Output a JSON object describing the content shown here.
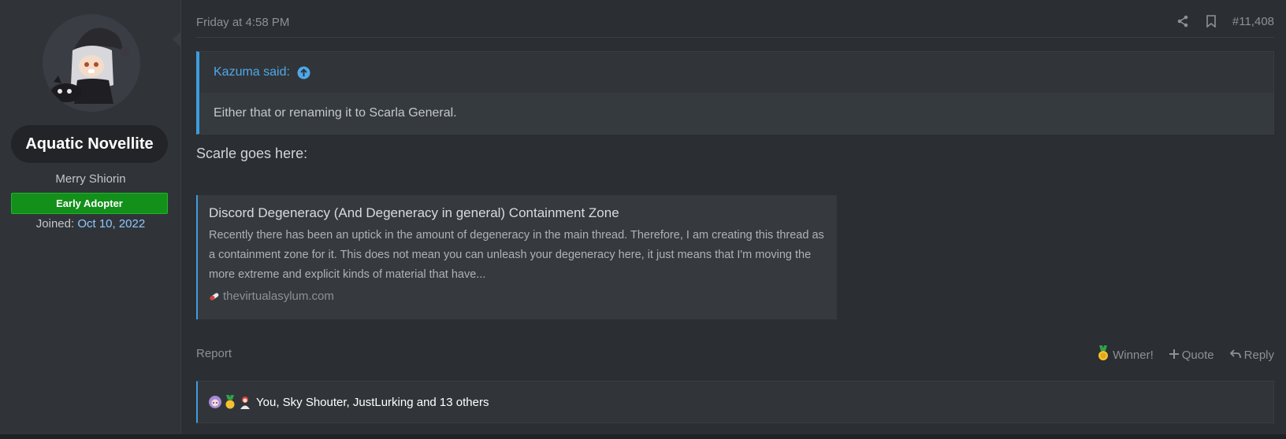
{
  "user": {
    "name": "Aquatic Novellite",
    "title": "Merry Shiorin",
    "banner": "Early Adopter",
    "joined_label": "Joined:",
    "joined_value": "Oct 10, 2022"
  },
  "post": {
    "date": "Friday at 4:58 PM",
    "number": "#11,408",
    "quote": {
      "author": "Kazuma said:",
      "text": "Either that or renaming it to Scarla General."
    },
    "text": "Scarle goes here:",
    "embed": {
      "title": "Discord Degeneracy (And Degeneracy in general) Containment Zone",
      "description": "Recently there has been an uptick in the amount of degeneracy in the main thread. Therefore, I am creating this thread as a containment zone for it. This does not mean you can unleash your degeneracy here, it just means that I'm moving the more extreme and explicit kinds of material that have...",
      "site": "thevirtualasylum.com"
    }
  },
  "footer": {
    "report": "Report",
    "winner": "Winner!",
    "quote": "Quote",
    "reply": "Reply"
  },
  "reactions": {
    "text": "You, Sky Shouter, JustLurking and 13 others",
    "icons": [
      "anime-girl-reaction-icon",
      "medal-reaction-icon",
      "character-reaction-icon"
    ]
  },
  "colors": {
    "accent": "#3d9de0",
    "banner": "#12901a",
    "link": "#8fc8ff"
  }
}
